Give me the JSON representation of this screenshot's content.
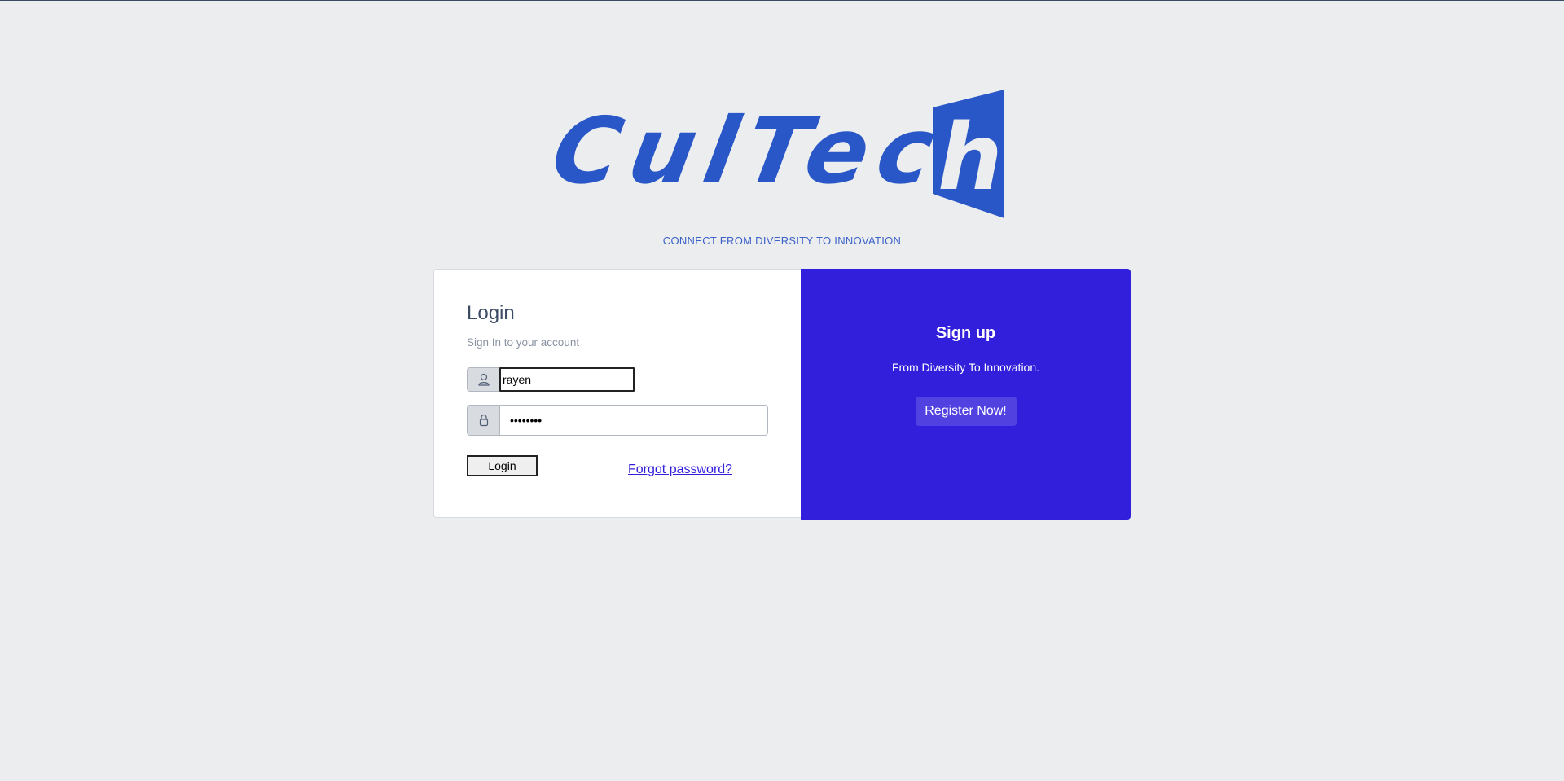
{
  "brand": {
    "logo_text": "CulTec",
    "logo_last_letter": "h",
    "tagline": "CONNECT FROM DIVERSITY TO INNOVATION",
    "color": "#2a57c7"
  },
  "login": {
    "title": "Login",
    "subtitle": "Sign In to your account",
    "username_value": "rayen",
    "password_value": "••••••••",
    "username_icon": "user-icon",
    "password_icon": "lock-icon",
    "login_button_label": "Login",
    "forgot_password_label": "Forgot password?"
  },
  "signup": {
    "title": "Sign up",
    "text": "From Diversity To Innovation.",
    "register_button_label": "Register Now!",
    "background_color": "#321fdb"
  }
}
